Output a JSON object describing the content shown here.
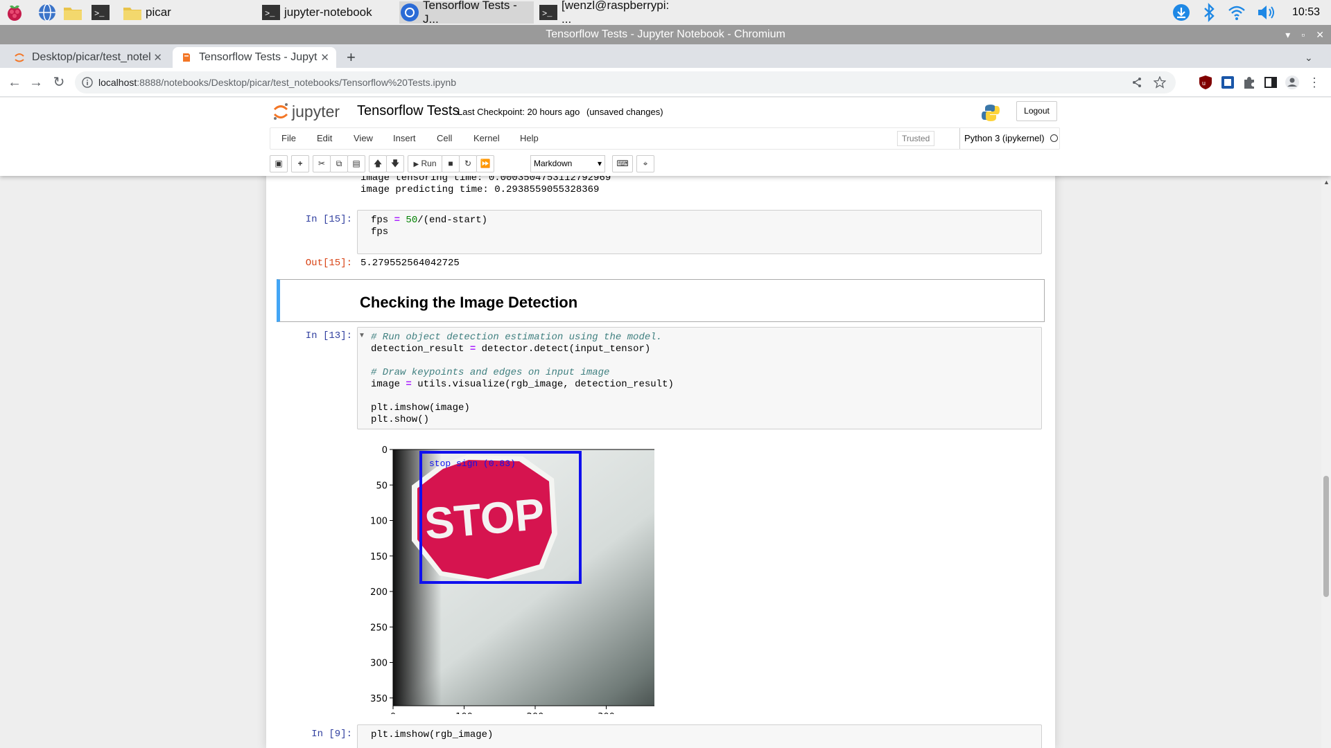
{
  "taskbar": {
    "tasks": [
      "picar",
      "jupyter-notebook",
      "Tensorflow Tests - J...",
      "[wenzl@raspberrypi: ..."
    ],
    "clock": "10:53"
  },
  "window": {
    "title": "Tensorflow Tests - Jupyter Notebook - Chromium"
  },
  "browser": {
    "tabs": [
      {
        "label": "Desktop/picar/test_notel",
        "active": false
      },
      {
        "label": "Tensorflow Tests - Jupyt",
        "active": true
      }
    ],
    "url_host": "localhost",
    "url_path": ":8888/notebooks/Desktop/picar/test_notebooks/Tensorflow%20Tests.ipynb"
  },
  "jupyter": {
    "logo_text": "jupyter",
    "notebook_name": "Tensorflow Tests",
    "checkpoint": "Last Checkpoint: 20 hours ago",
    "unsaved": "(unsaved changes)",
    "logout": "Logout",
    "menu": [
      "File",
      "Edit",
      "View",
      "Insert",
      "Cell",
      "Kernel",
      "Help"
    ],
    "trusted": "Trusted",
    "kernel": "Python 3 (ipykernel)",
    "run_label": "Run",
    "cell_type": "Markdown"
  },
  "cells": {
    "prev_output": [
      "image tensoring time: 0.00035047531127929​69",
      "image predicting time: 0.2938559055328369"
    ],
    "cell15": {
      "prompt": "In [15]:",
      "line1_a": "fps ",
      "line1_op": "=",
      "line1_num": " 50",
      "line1_b": "/(end-start)",
      "line2": "fps"
    },
    "out15": {
      "prompt": "Out[15]:",
      "value": "5.279552564042725"
    },
    "markdown_heading": "Checking the Image Detection",
    "cell13": {
      "prompt": "In [13]:",
      "comment1": "# Run object detection estimation using the model.",
      "line2_a": "detection_result ",
      "line2_op": "=",
      "line2_b": " detector.detect(input_tensor)",
      "comment2": "# Draw keypoints and edges on input image",
      "line5_a": "image ",
      "line5_op": "=",
      "line5_b": " utils.visualize(rgb_image, detection_result)",
      "line7": "plt.imshow(image)",
      "line8": "plt.show()"
    },
    "plot": {
      "y_ticks": [
        "0",
        "50",
        "100",
        "150",
        "200",
        "250",
        "300",
        "350"
      ],
      "x_ticks": [
        "0",
        "100",
        "200",
        "300",
        "400"
      ],
      "detection_label": "stop sign (0.83)",
      "sign_text": "STOP",
      "box_color": "#1010ee"
    },
    "cell9": {
      "prompt": "In [9]:",
      "line1": "plt.imshow(rgb_image)"
    }
  }
}
